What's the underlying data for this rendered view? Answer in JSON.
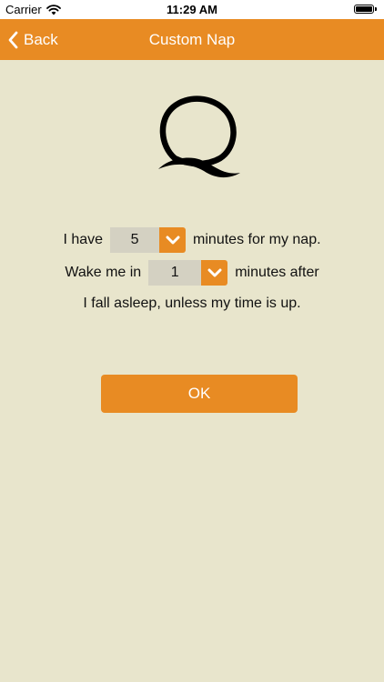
{
  "status_bar": {
    "carrier": "Carrier",
    "time": "11:29 AM",
    "battery_level": 1.0
  },
  "nav": {
    "back_label": "Back",
    "title": "Custom Nap"
  },
  "logo": {
    "icon": "q-logo-icon"
  },
  "form": {
    "row1_prefix": "I have",
    "nap_minutes": "5",
    "row1_suffix": "minutes for my nap.",
    "row2_prefix": "Wake me in",
    "wake_minutes": "1",
    "row2_suffix": "minutes after",
    "row3_text": "I fall asleep, unless my time is up."
  },
  "ok_label": "OK",
  "colors": {
    "accent": "#e88b23",
    "background": "#e8e5cc",
    "picker_bg": "#d4d1c2"
  }
}
